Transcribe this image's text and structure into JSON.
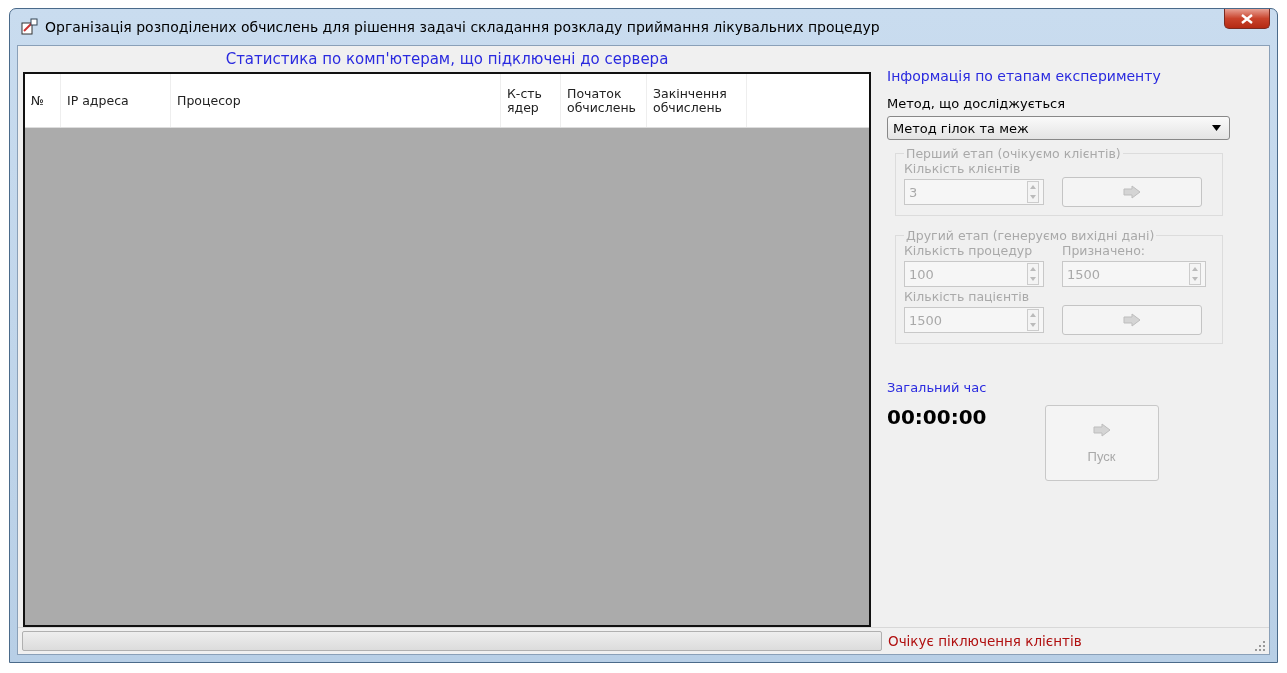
{
  "window": {
    "title": "Організація розподілених обчислень для рішення задачі складання розкладу приймання лікувальних процедур"
  },
  "computers": {
    "title": "Статистика по комп'ютерам, що підключені до сервера",
    "columns": [
      "№",
      "IP адреса",
      "Процесор",
      "К-сть ядер",
      "Початок обчислень",
      "Закінчення обчислень"
    ]
  },
  "experiment": {
    "title": "Інформація по етапам експерименту",
    "method_label": "Метод, що досліджується",
    "method": {
      "value": "Метод гілок та меж"
    },
    "stages": [
      {
        "title": "Перший етап (очікуємо клієнтів)",
        "disabled": true,
        "fields": [
          {
            "label": "Кількість клієнтів",
            "value": "3"
          }
        ]
      },
      {
        "title": "Другий етап (генеруємо вихідні дані)",
        "disabled": true,
        "fields": [
          {
            "label": "Кількість процедур",
            "value": "100"
          },
          {
            "label": "Призначено:",
            "value": "1500"
          },
          {
            "label": "Кількість пацієнтів",
            "value": "1500"
          }
        ]
      }
    ],
    "total_time": {
      "label": "Загальний час",
      "value": "00:00:00"
    },
    "start_button": {
      "label": "Пуск",
      "disabled": true
    }
  },
  "status_bar": {
    "progress": {
      "level": 0
    },
    "message": "Очікує піключення клієнтів"
  }
}
